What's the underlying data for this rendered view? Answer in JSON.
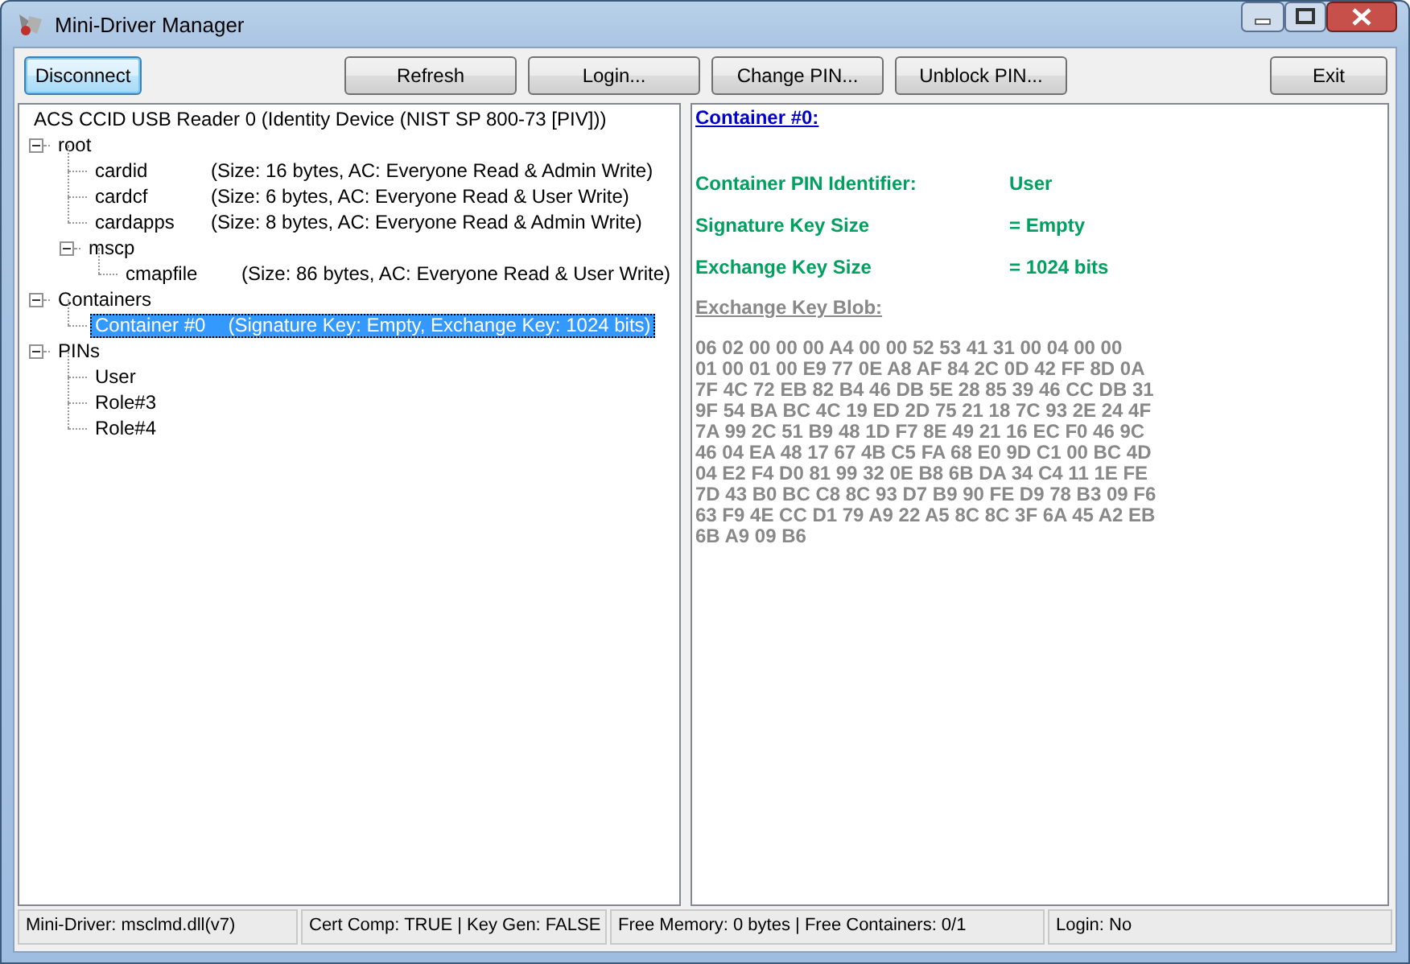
{
  "window": {
    "title": "Mini-Driver Manager"
  },
  "toolbar": {
    "left": [
      {
        "label": "Disconnect",
        "focused": true
      }
    ],
    "center": [
      {
        "label": "Refresh",
        "focused": false
      },
      {
        "label": "Login...",
        "focused": false
      },
      {
        "label": "Change PIN...",
        "focused": false
      },
      {
        "label": "Unblock PIN...",
        "focused": false
      }
    ],
    "right": [
      {
        "label": "Exit",
        "focused": false
      }
    ]
  },
  "tree": {
    "items": [
      {
        "label": "ACS CCID USB Reader 0 (Identity Device (NIST SP 800-73 [PIV]))",
        "selected": false,
        "children": [
          {
            "label": "root",
            "selected": false,
            "expanded": true,
            "children": [
              {
                "label": "cardid",
                "info": "(Size: 16 bytes, AC: Everyone Read & Admin Write)",
                "selected": false
              },
              {
                "label": "cardcf",
                "info": "(Size: 6 bytes, AC: Everyone Read & User Write)",
                "selected": false
              },
              {
                "label": "cardapps",
                "info": "(Size: 8 bytes, AC: Everyone Read & Admin Write)",
                "selected": false
              },
              {
                "label": "mscp",
                "selected": false,
                "expanded": true,
                "children": [
                  {
                    "label": "cmapfile",
                    "info": "(Size: 86 bytes, AC: Everyone Read & User Write)",
                    "selected": false
                  }
                ]
              }
            ]
          },
          {
            "label": "Containers",
            "selected": false,
            "expanded": true,
            "children": [
              {
                "label": "Container #0",
                "info": "(Signature Key: Empty, Exchange Key: 1024 bits)",
                "selected": true
              }
            ]
          },
          {
            "label": "PINs",
            "selected": false,
            "expanded": true,
            "children": [
              {
                "label": "User",
                "selected": false
              },
              {
                "label": "Role#3",
                "selected": false
              },
              {
                "label": "Role#4",
                "selected": false
              }
            ]
          }
        ]
      }
    ]
  },
  "details": {
    "heading": "Container #0:",
    "fields": [
      {
        "label": "Container PIN Identifier:",
        "value": "User"
      },
      {
        "label": "Signature Key Size",
        "value": "= Empty"
      },
      {
        "label": "Exchange Key Size",
        "value": "= 1024 bits"
      }
    ],
    "blob_heading": "Exchange Key Blob:",
    "blob_lines": [
      "06 02 00 00 00 A4 00 00 52 53 41 31 00 04 00 00",
      "01 00 01 00 E9 77 0E A8 AF 84 2C 0D 42 FF 8D 0A",
      "7F 4C 72 EB 82 B4 46 DB 5E 28 85 39 46 CC DB 31",
      "9F 54 BA BC 4C 19 ED 2D 75 21 18 7C 93 2E 24 4F",
      "7A 99 2C 51 B9 48 1D F7 8E 49 21 16 EC F0 46 9C",
      "46 04 EA 48 17 67 4B C5 FA 68 E0 9D C1 00 BC 4D",
      "04 E2 F4 D0 81 99 32 0E B8 6B DA 34 C4 11 1E FE",
      "7D 43 B0 BC C8 8C 93 D7 B9 90 FE D9 78 B3 09 F6",
      "63 F9 4E CC D1 79 A9 22 A5 8C 8C 3F 6A 45 A2 EB",
      "6B A9 09 B6"
    ]
  },
  "status_bar": [
    "Mini-Driver: msclmd.dll(v7)",
    "Cert Comp: TRUE | Key Gen: FALSE",
    "Free Memory: 0 bytes | Free Containers: 0/1",
    "Login: No"
  ]
}
